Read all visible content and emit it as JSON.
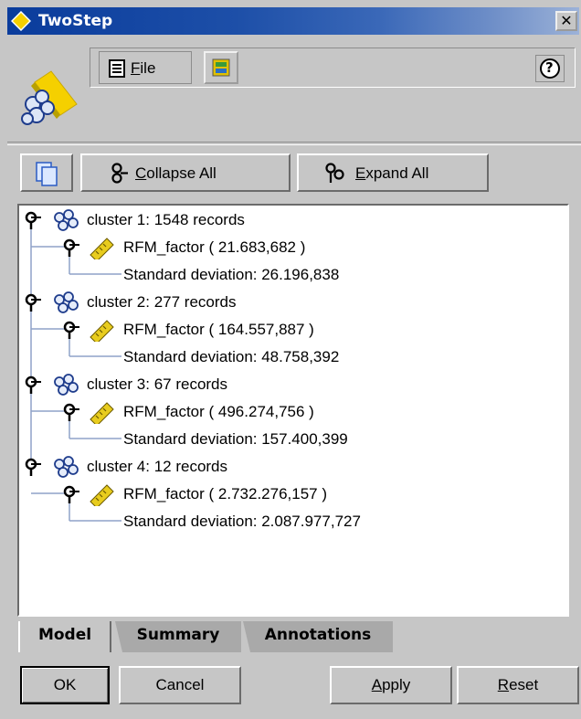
{
  "window": {
    "title": "TwoStep",
    "close_glyph": "✕"
  },
  "menu": {
    "file_label_first": "F",
    "file_label_rest": "ile",
    "help_glyph": "?"
  },
  "toolbar": {
    "collapse_first": "C",
    "collapse_rest": "ollapse All",
    "expand_first": "E",
    "expand_rest": "xpand All"
  },
  "tree": {
    "clusters": [
      {
        "label": "cluster 1: 1548 records",
        "factor": "RFM_factor ( 21.683,682 )",
        "std": "Standard deviation: 26.196,838"
      },
      {
        "label": "cluster 2: 277 records",
        "factor": "RFM_factor ( 164.557,887 )",
        "std": "Standard deviation: 48.758,392"
      },
      {
        "label": "cluster 3: 67 records",
        "factor": "RFM_factor ( 496.274,756 )",
        "std": "Standard deviation: 157.400,399"
      },
      {
        "label": "cluster 4: 12 records",
        "factor": "RFM_factor ( 2.732.276,157 )",
        "std": "Standard deviation: 2.087.977,727"
      }
    ]
  },
  "tabs": {
    "model": "Model",
    "summary": "Summary",
    "annotations": "Annotations"
  },
  "buttons": {
    "ok": "OK",
    "cancel": "Cancel",
    "apply_first": "A",
    "apply_rest": "pply",
    "reset_first": "R",
    "reset_rest": "eset"
  },
  "colors": {
    "title_bar": "#0a3c9c",
    "window_bg": "#c6c6c6",
    "panel_bg": "#ffffff"
  },
  "icons": {
    "title": "node-diamond-icon",
    "file": "document-list-icon",
    "extra": "generate-icon",
    "help": "help-icon",
    "node": "twostep-node-icon",
    "copy": "copy-icon",
    "collapse": "collapse-icon",
    "expand": "expand-icon",
    "pin": "tree-pin-icon",
    "cluster": "cluster-icon",
    "field": "ruler-field-icon"
  }
}
